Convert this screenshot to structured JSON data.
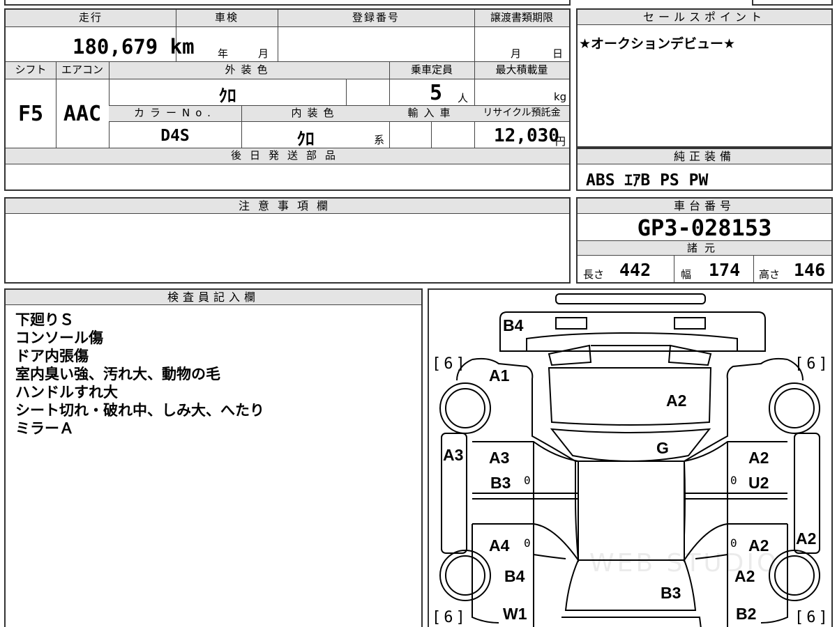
{
  "spec": {
    "mileage_label": "走行",
    "mileage_value": "180,679 km",
    "inspection_label": "車検",
    "inspection_year_unit": "年",
    "inspection_month_unit": "月",
    "registration_label": "登録番号",
    "transfer_deadline_label": "譲渡書類期限",
    "transfer_month_unit": "月",
    "transfer_day_unit": "日",
    "shift_label": "シフト",
    "shift_value": "F5",
    "ac_label": "エアコン",
    "ac_value": "AAC",
    "exterior_color_label": "外装色",
    "exterior_color_value": "ｸﾛ",
    "capacity_label": "乗車定員",
    "capacity_value": "5",
    "capacity_unit": "人",
    "max_load_label": "最大積載量",
    "max_load_unit": "kg",
    "color_no_label": "カラーNo.",
    "color_no_value": "D4S",
    "interior_color_label": "内装色",
    "interior_color_value": "ｸﾛ",
    "interior_color_suffix": "系",
    "import_label": "輸入車",
    "recycle_label": "リサイクル預託金",
    "recycle_value": "12,030",
    "recycle_unit": "円",
    "later_parts_label": "後日発送部品"
  },
  "sales_point": {
    "label": "セールスポイント",
    "text": "★オークションデビュー★"
  },
  "equipment": {
    "label": "純正装備",
    "value": "ABS ｴｱB PS PW"
  },
  "caution": {
    "label": "注意事項欄"
  },
  "chassis": {
    "label": "車台番号",
    "value": "GP3-028153",
    "dims_label": "諸元",
    "length_label": "長さ",
    "length_value": "442",
    "width_label": "幅",
    "width_value": "174",
    "height_label": "高さ",
    "height_value": "146"
  },
  "inspector": {
    "label": "検査員記入欄",
    "lines": [
      "下廻りＳ",
      "コンソール傷",
      "ドア内張傷",
      "室内臭い強、汚れ大、動物の毛",
      "ハンドルすれ大",
      "シート切れ・破れ中、しみ大、へたり",
      "ミラーＡ"
    ]
  },
  "diagram": {
    "marks": {
      "rear_b4": "B4",
      "left_front_a1": "A1",
      "hood_a2": "A2",
      "windshield_g": "G",
      "left_fender_a3": "A3",
      "left_front_door_a3": "A3",
      "left_front_door_b3": "B3",
      "left_rear_door_a4": "A4",
      "left_rear_b4": "B4",
      "left_rear_w1": "W1",
      "right_front_door_a2": "A2",
      "right_front_door_u2": "U2",
      "right_rear_door_a2": "A2",
      "right_quarter_a2": "A2",
      "right_rear_a2": "A2",
      "roof_b3": "B3",
      "right_rear_b2": "B2"
    },
    "tires": {
      "front_left": "6",
      "front_right": "6",
      "rear_left": "6",
      "rear_right": "6"
    },
    "zeros": [
      "0",
      "0",
      "0",
      "0"
    ],
    "watermark": "WEB STUDIO"
  }
}
